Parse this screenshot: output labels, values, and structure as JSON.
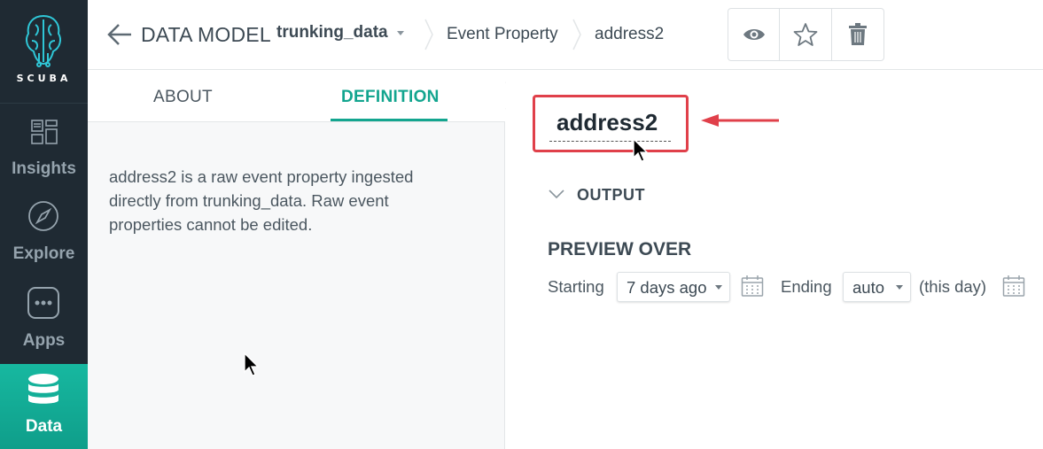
{
  "sidebar": {
    "logo_text": "SCUBA",
    "items": [
      {
        "label": "Insights",
        "icon": "insights-icon",
        "active": false
      },
      {
        "label": "Explore",
        "icon": "compass-icon",
        "active": false
      },
      {
        "label": "Apps",
        "icon": "apps-grid-icon",
        "active": false
      },
      {
        "label": "Data",
        "icon": "database-icon",
        "active": true
      }
    ]
  },
  "header": {
    "section": "DATA MODEL",
    "dataset": "trunking_data",
    "breadcrumbs": [
      "Event Property",
      "address2"
    ],
    "toolbar": [
      "eye-icon",
      "star-icon",
      "trash-icon"
    ]
  },
  "tabs": [
    {
      "label": "ABOUT",
      "active": false
    },
    {
      "label": "DEFINITION",
      "active": true
    }
  ],
  "about_text": "address2 is a raw event property ingested directly from trunking_data. Raw event properties cannot be edited.",
  "property": {
    "name": "address2"
  },
  "output": {
    "label": "OUTPUT"
  },
  "preview": {
    "title": "PREVIEW OVER",
    "starting_label": "Starting",
    "starting_value": "7 days ago",
    "ending_label": "Ending",
    "ending_value": "auto",
    "ending_suffix": "(this day)"
  },
  "colors": {
    "sidebar_bg": "#1f2a33",
    "accent": "#13a58f",
    "highlight_red": "#e0404a"
  }
}
